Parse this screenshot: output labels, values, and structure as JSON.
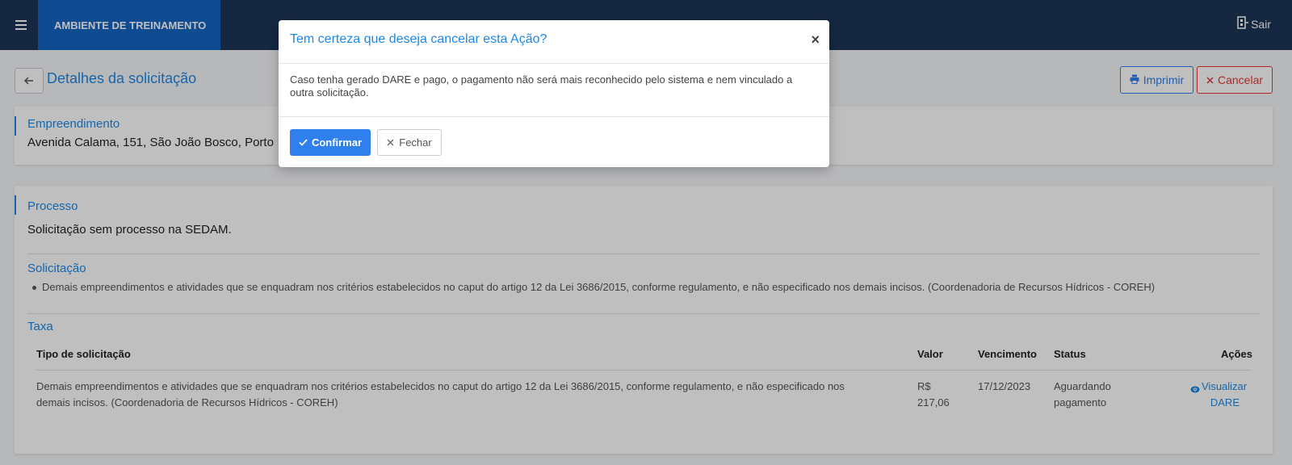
{
  "header": {
    "brand": "AMBIENTE DE TREINAMENTO",
    "logout_label": "Sair"
  },
  "page": {
    "title": "Detalhes da solicitação",
    "print_label": "Imprimir",
    "cancel_label": "Cancelar"
  },
  "empreendimento": {
    "label": "Empreendimento",
    "address": "Avenida Calama, 151, São João Bosco, Porto"
  },
  "processo": {
    "label": "Processo",
    "text": "Solicitação sem processo na SEDAM."
  },
  "solicitacao": {
    "label": "Solicitação",
    "items": [
      "Demais empreendimentos e atividades que se enquadram nos critérios estabelecidos no caput do artigo 12 da Lei 3686/2015, conforme regulamento, e não especificado nos demais incisos. (Coordenadoria de Recursos Hídricos - COREH)"
    ]
  },
  "taxa": {
    "label": "Taxa",
    "columns": [
      "Tipo de solicitação",
      "Valor",
      "Vencimento",
      "Status",
      "Ações"
    ],
    "rows": [
      {
        "tipo_line1": "Demais empreendimentos e atividades que se enquadram nos critérios estabelecidos no caput do artigo 12 da Lei 3686/2015, conforme regulamento, e não especificado nos",
        "tipo_line2": "demais incisos. (Coordenadoria de Recursos Hídricos - COREH)",
        "valor_line1": "R$",
        "valor_line2": "217,06",
        "vencimento": "17/12/2023",
        "status_line1": "Aguardando",
        "status_line2": "pagamento",
        "action_line1": "Visualizar",
        "action_line2": "DARE"
      }
    ]
  },
  "modal": {
    "title": "Tem certeza que deseja cancelar esta Ação?",
    "close_glyph": "×",
    "body": "Caso tenha gerado DARE e pago, o pagamento não será mais reconhecido pelo sistema e nem vinculado a outra solicitação.",
    "confirm_label": "Confirmar",
    "close_label": "Fechar"
  },
  "colors": {
    "topbar": "#1d3557",
    "brand": "#1565c0",
    "accent": "#1e88e5",
    "danger": "#e53935"
  }
}
